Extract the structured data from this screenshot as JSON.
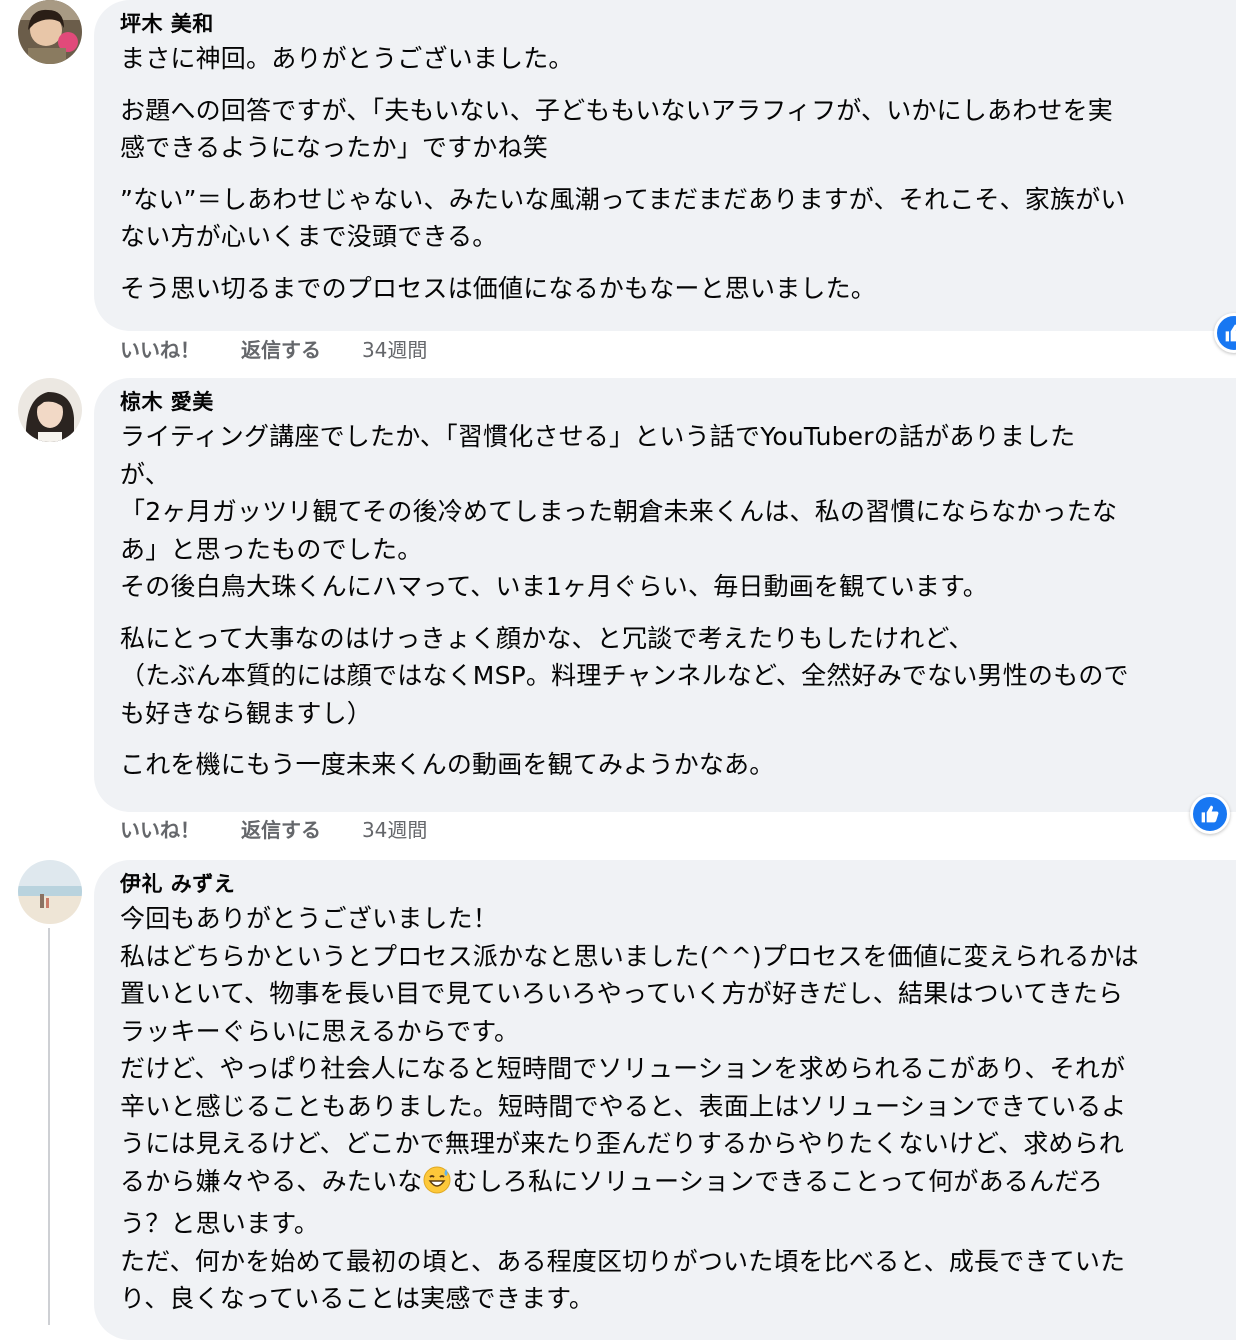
{
  "comments": [
    {
      "author": "坪木 美和",
      "lines": [
        "まさに神回。ありがとうございました。",
        "お題への回答ですが、「夫もいない、子どももいないアラフィフが、いかにしあわせを実",
        "感できるようになったか」ですかね笑",
        "”ない”＝しあわせじゃない、みたいな風潮ってまだまだありますが、それこそ、家族がい",
        "ない方が心いくまで没頭できる。",
        "そう思い切るまでのプロセスは価値になるかもなーと思いました。"
      ],
      "like_label": "いいね！",
      "reply_label": "返信する",
      "time": "34週間"
    },
    {
      "author": "椋木 愛美",
      "lines": [
        "ライティング講座でしたか、「習慣化させる」という話でYouTuberの話がありました",
        "が、",
        "「2ヶ月ガッツリ観てその後冷めてしまった朝倉未来くんは、私の習慣にならなかったな",
        "あ」と思ったものでした。",
        "その後白鳥大珠くんにハマって、いま1ヶ月ぐらい、毎日動画を観ています。",
        "私にとって大事なのはけっきょく顔かな、と冗談で考えたりもしたけれど、",
        "（たぶん本質的には顔ではなくMSP。料理チャンネルなど、全然好みでない男性のもので",
        "も好きなら観ますし）",
        "これを機にもう一度未来くんの動画を観てみようかなあ。"
      ],
      "like_label": "いいね！",
      "reply_label": "返信する",
      "time": "34週間"
    },
    {
      "author": "伊礼 みずえ",
      "lines": [
        "今回もありがとうございました！",
        "私はどちらかというとプロセス派かなと思いました(^^)プロセスを価値に変えられるかは",
        "置いといて、物事を長い目で見ていろいろやっていく方が好きだし、結果はついてきたら",
        "ラッキーぐらいに思えるからです。",
        "だけど、やっぱり社会人になると短時間でソリューションを求められるこがあり、それが",
        "辛いと感じることもありました。短時間でやると、表面上はソリューションできているよ",
        "うには見えるけど、どこかで無理が来たり歪んだりするからやりたくないけど、求められ",
        "るから嫌々やる、みたいな",
        "むしろ私にソリューションできることって何があるんだろ",
        "う？と思います。",
        "ただ、何かを始めて最初の頃と、ある程度区切りがついた頃を比べると、成長できていた",
        "り、良くなっていることは実感できます。"
      ]
    }
  ],
  "colors": {
    "bubble": "#f0f2f5",
    "meta": "#65676b",
    "like": "#1877f2"
  },
  "icons": {
    "like_badge": "thumbs-up-icon",
    "emoji": "grinning-sweat-emoji"
  }
}
